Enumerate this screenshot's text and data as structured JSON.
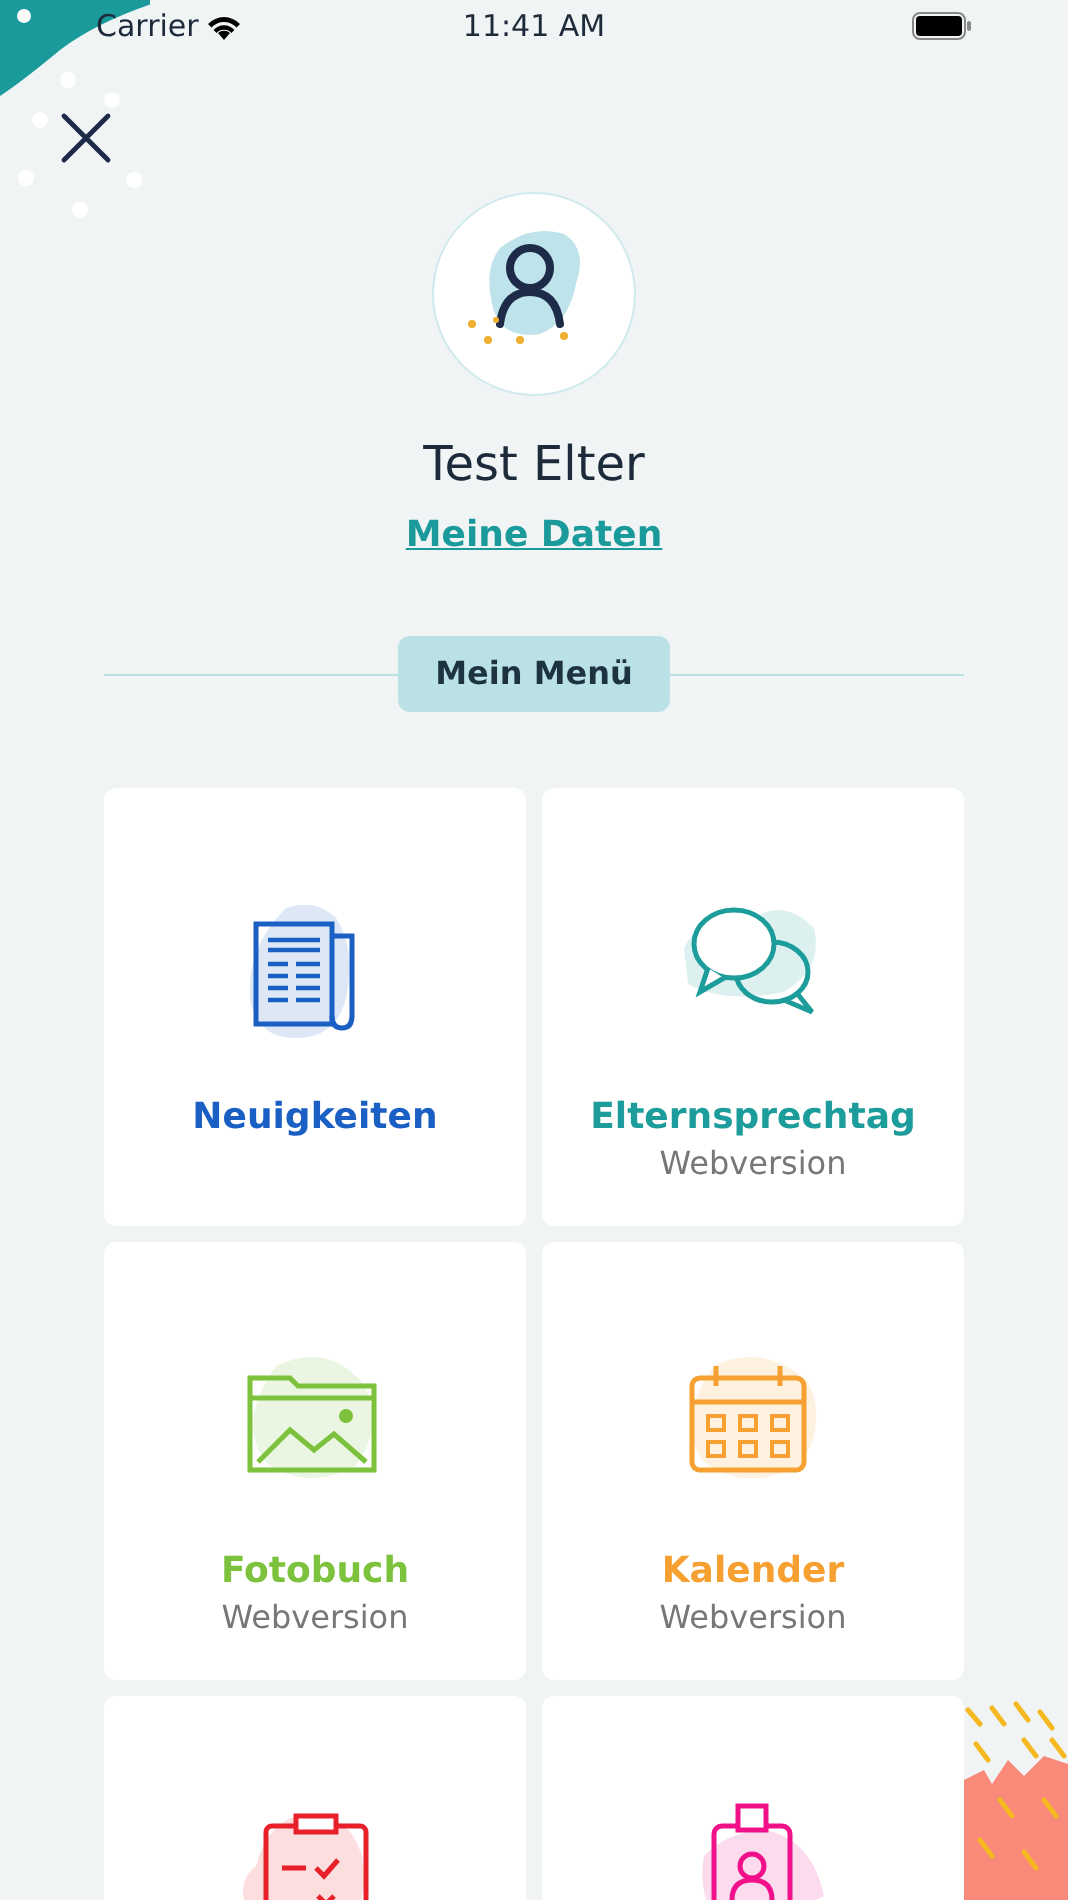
{
  "status_bar": {
    "carrier": "Carrier",
    "time": "11:41 AM"
  },
  "profile": {
    "name": "Test Elter",
    "link": "Meine Daten"
  },
  "menu_heading": "Mein Menü",
  "tiles": [
    {
      "title": "Neuigkeiten",
      "color": "#1a5fc4"
    },
    {
      "title": "Elternsprechtag",
      "subtitle": "Webversion",
      "color": "#1c9c9a"
    },
    {
      "title": "Fotobuch",
      "subtitle": "Webversion",
      "color": "#7cc23c"
    },
    {
      "title": "Kalender",
      "subtitle": "Webversion",
      "color": "#f5a030"
    },
    {
      "color": "#e8202a"
    },
    {
      "color": "#f0108a"
    }
  ]
}
